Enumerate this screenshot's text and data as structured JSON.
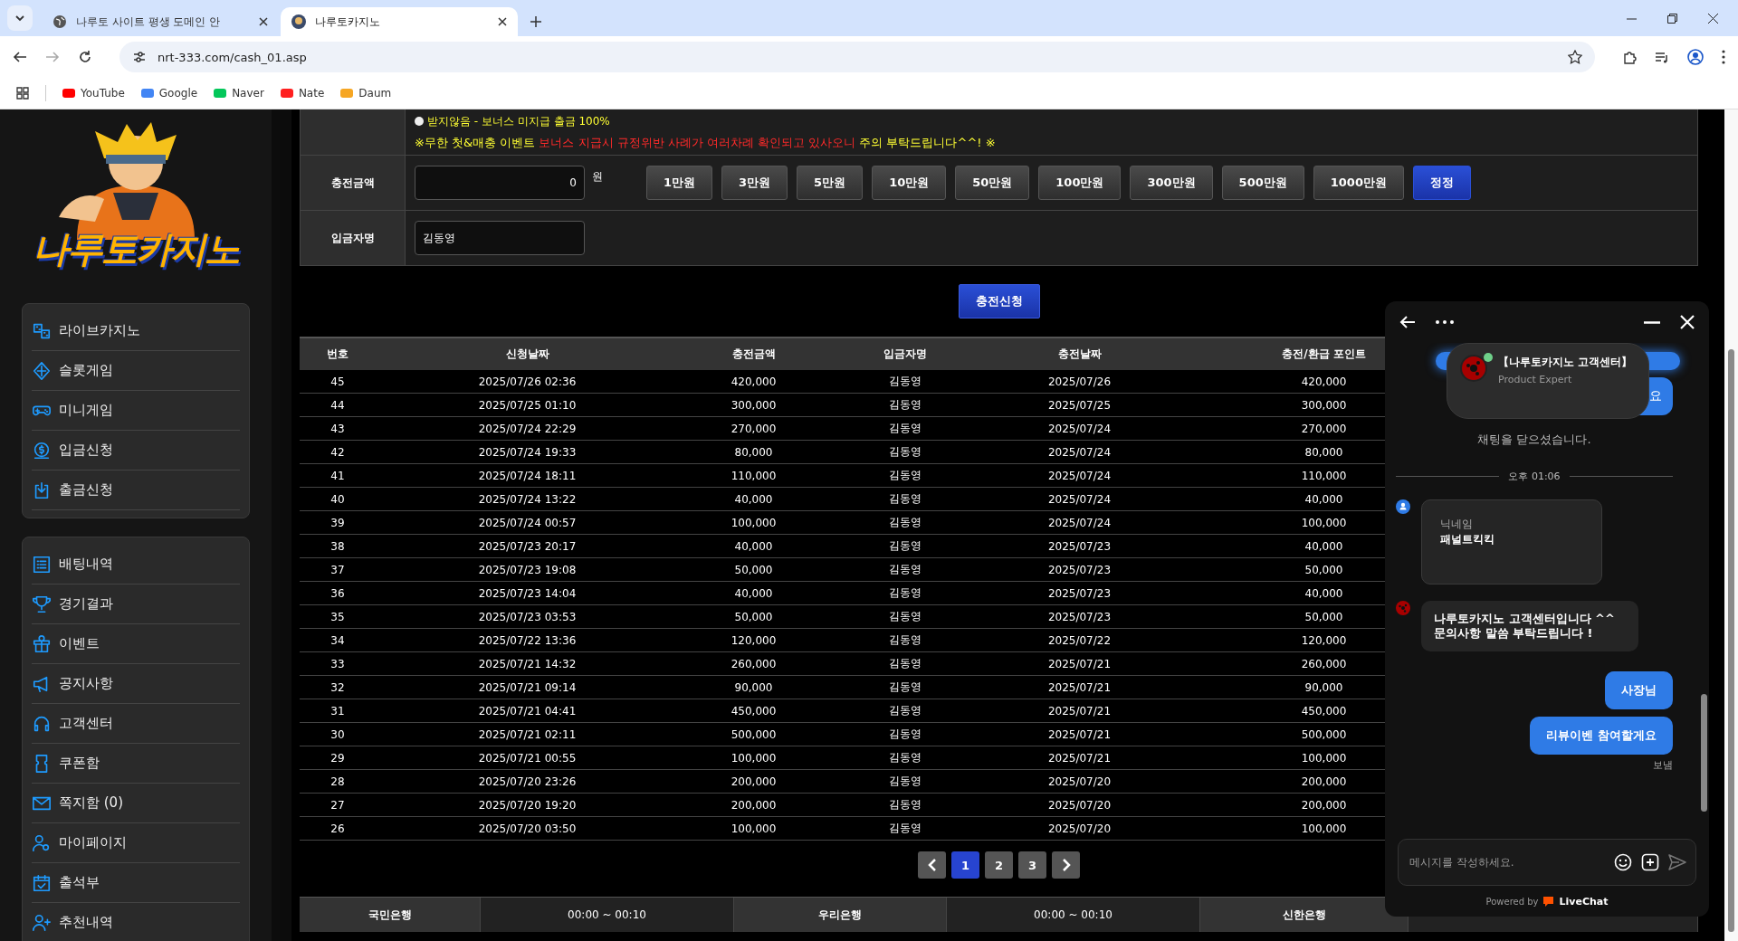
{
  "browser": {
    "tabs": [
      {
        "title": "나루토 사이트 평생 도메인 안",
        "selected": false
      },
      {
        "title": "나루토카지노",
        "selected": true
      }
    ],
    "address": "nrt-333.com/cash_01.asp",
    "bookmarks": [
      "YouTube",
      "Google",
      "Naver",
      "Nate",
      "Daum"
    ]
  },
  "sidebar": {
    "logo": "나루토카지노",
    "groups": [
      [
        "라이브카지노",
        "슬롯게임",
        "미니게임",
        "입금신청",
        "출금신청"
      ],
      [
        "배팅내역",
        "경기결과",
        "이벤트",
        "공지사항",
        "고객센터",
        "쿠폰함",
        "쪽지함 (0)",
        "마이페이지",
        "출석부",
        "추천내역"
      ]
    ]
  },
  "form": {
    "option": {
      "label": "받지않음 - 보너스 미지급 출금 100%",
      "selected": false
    },
    "notice": [
      {
        "text": "※무한 첫&매충 이벤트 ",
        "color": "#ffff33"
      },
      {
        "text": "보너스 지급시 규정위반 사례가 여러차례 확인되고 있사오니",
        "color": "#ff2a2a"
      },
      {
        "text": " 주의 부탁드립니다^^! ※",
        "color": "#ffff33"
      }
    ],
    "amount": {
      "label": "충전금액",
      "value": "0",
      "unit": "원",
      "buttons": [
        {
          "label": "1만원",
          "kind": "amount"
        },
        {
          "label": "3만원",
          "kind": "amount"
        },
        {
          "label": "5만원",
          "kind": "amount"
        },
        {
          "label": "10만원",
          "kind": "amount"
        },
        {
          "label": "50만원",
          "kind": "amount"
        },
        {
          "label": "100만원",
          "kind": "amount"
        },
        {
          "label": "300만원",
          "kind": "amount"
        },
        {
          "label": "500만원",
          "kind": "amount"
        },
        {
          "label": "1000만원",
          "kind": "amount"
        },
        {
          "label": "정정",
          "kind": "reset"
        }
      ]
    },
    "depositor": {
      "label": "입금자명",
      "value": "김동영"
    },
    "submit": "충전신청"
  },
  "table": {
    "columns": [
      "번호",
      "신청날짜",
      "충전금액",
      "입금자명",
      "충전날짜",
      "충전/환급 포인트"
    ],
    "rows": [
      [
        "45",
        "2025/07/26 02:36",
        "420,000",
        "김동영",
        "2025/07/26",
        "420,000"
      ],
      [
        "44",
        "2025/07/25 01:10",
        "300,000",
        "김동영",
        "2025/07/25",
        "300,000"
      ],
      [
        "43",
        "2025/07/24 22:29",
        "270,000",
        "김동영",
        "2025/07/24",
        "270,000"
      ],
      [
        "42",
        "2025/07/24 19:33",
        "80,000",
        "김동영",
        "2025/07/24",
        "80,000"
      ],
      [
        "41",
        "2025/07/24 18:11",
        "110,000",
        "김동영",
        "2025/07/24",
        "110,000"
      ],
      [
        "40",
        "2025/07/24 13:22",
        "40,000",
        "김동영",
        "2025/07/24",
        "40,000"
      ],
      [
        "39",
        "2025/07/24 00:57",
        "100,000",
        "김동영",
        "2025/07/24",
        "100,000"
      ],
      [
        "38",
        "2025/07/23 20:17",
        "40,000",
        "김동영",
        "2025/07/23",
        "40,000"
      ],
      [
        "37",
        "2025/07/23 19:08",
        "50,000",
        "김동영",
        "2025/07/23",
        "50,000"
      ],
      [
        "36",
        "2025/07/23 14:04",
        "40,000",
        "김동영",
        "2025/07/23",
        "40,000"
      ],
      [
        "35",
        "2025/07/23 03:53",
        "50,000",
        "김동영",
        "2025/07/23",
        "50,000"
      ],
      [
        "34",
        "2025/07/22 13:36",
        "120,000",
        "김동영",
        "2025/07/22",
        "120,000"
      ],
      [
        "33",
        "2025/07/21 14:32",
        "260,000",
        "김동영",
        "2025/07/21",
        "260,000"
      ],
      [
        "32",
        "2025/07/21 09:14",
        "90,000",
        "김동영",
        "2025/07/21",
        "90,000"
      ],
      [
        "31",
        "2025/07/21 04:41",
        "450,000",
        "김동영",
        "2025/07/21",
        "450,000"
      ],
      [
        "30",
        "2025/07/21 02:11",
        "500,000",
        "김동영",
        "2025/07/21",
        "500,000"
      ],
      [
        "29",
        "2025/07/21 00:55",
        "100,000",
        "김동영",
        "2025/07/21",
        "100,000"
      ],
      [
        "28",
        "2025/07/20 23:26",
        "200,000",
        "김동영",
        "2025/07/20",
        "200,000"
      ],
      [
        "27",
        "2025/07/20 19:20",
        "200,000",
        "김동영",
        "2025/07/20",
        "200,000"
      ],
      [
        "26",
        "2025/07/20 03:50",
        "100,000",
        "김동영",
        "2025/07/20",
        "100,000"
      ]
    ]
  },
  "pagination": [
    {
      "label": "1",
      "selected": true
    },
    {
      "label": "2",
      "selected": false
    },
    {
      "label": "3",
      "selected": false
    }
  ],
  "banks": [
    {
      "text": "국민은행",
      "kind": "bank"
    },
    {
      "text": "00:00 ~ 00:10",
      "kind": "time"
    },
    {
      "text": "우리은행",
      "kind": "bank"
    },
    {
      "text": "00:00 ~ 00:10",
      "kind": "time"
    },
    {
      "text": "신한은행",
      "kind": "bank"
    }
  ],
  "chat": {
    "agent": {
      "name": "【나루토카지노 고객센터】",
      "role": "Product Expert",
      "online": true
    },
    "covered_bubble": "요",
    "system": "채팅을 닫으셨습니다.",
    "divider": "오후 01:06",
    "form_card": {
      "label": "닉네임",
      "value": "패널트킥킥"
    },
    "agent_message": "나루토카지노 고객센터입니다 ^^ 문의사항 말씀 부탁드립니다 !",
    "visitor_messages": [
      "사장님",
      "리뷰이벤 참여할게요"
    ],
    "status": "보냄",
    "placeholder": "메시지를 작성하세요.",
    "powered_by": "Powered by",
    "brand": "LiveChat"
  }
}
